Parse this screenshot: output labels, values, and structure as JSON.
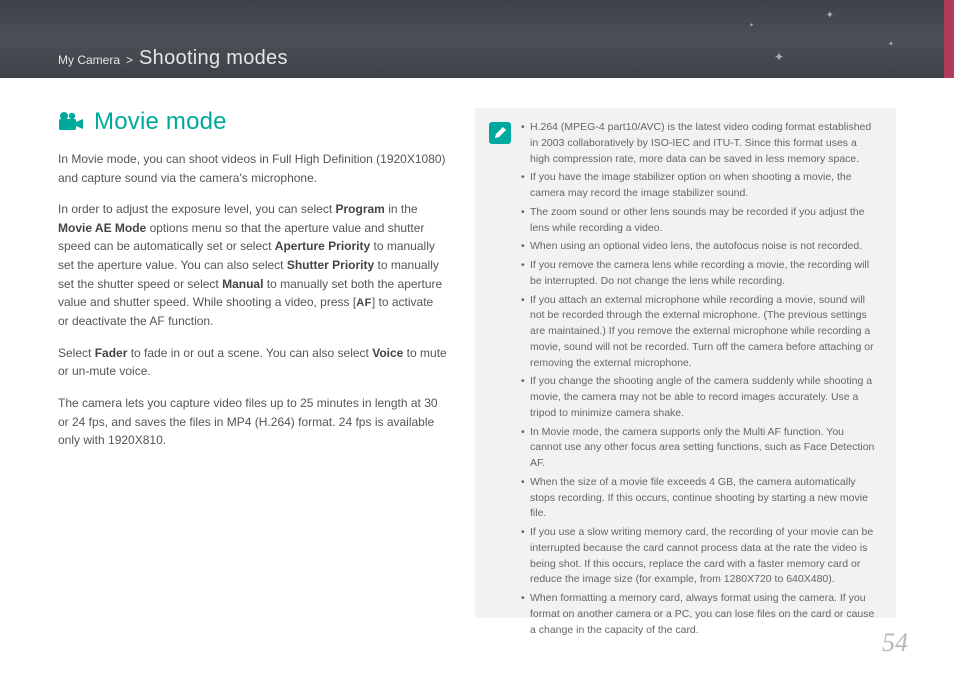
{
  "header": {
    "breadcrumb_category": "My Camera",
    "breadcrumb_sep": ">",
    "breadcrumb_section": "Shooting modes"
  },
  "heading": "Movie mode",
  "paragraphs": {
    "p1": "In Movie mode, you can shoot videos in Full High Definition (1920X1080) and capture sound via the camera's microphone.",
    "p2a": "In order to adjust the exposure level, you can select ",
    "p2_program": "Program",
    "p2b": " in the ",
    "p2_movieae": "Movie AE Mode",
    "p2c": " options menu so that the aperture value and shutter speed can be automatically set or select ",
    "p2_apPriority": "Aperture Priority",
    "p2d": " to manually set the aperture value. You can also select ",
    "p2_shPriority": "Shutter Priority",
    "p2e": " to manually set the shutter speed or select ",
    "p2_manual": "Manual",
    "p2f": " to manually set both the aperture value and shutter speed. While shooting a video, press [",
    "p2_af": "AF",
    "p2g": "] to activate or deactivate the AF function.",
    "p3a": "Select ",
    "p3_fader": "Fader",
    "p3b": " to fade in or out a scene. You can also select ",
    "p3_voice": "Voice",
    "p3c": " to mute or un-mute voice.",
    "p4": "The camera lets you capture video files up to 25 minutes in length at 30 or 24 fps, and saves the files in MP4 (H.264) format. 24 fps is available only with 1920X810."
  },
  "notes": [
    "H.264 (MPEG-4 part10/AVC) is the latest video coding format established in 2003 collaboratively by ISO-IEC and ITU-T. Since this format uses a high compression rate, more data can be saved in less memory space.",
    "If you have the image stabilizer option on when shooting a movie, the camera may record the image stabilizer sound.",
    "The zoom sound or other lens sounds may be recorded if you adjust the lens while recording a video.",
    "When using an optional video lens, the autofocus noise is not recorded.",
    "If you remove the camera lens while recording a movie, the recording will be interrupted. Do not change the lens while recording.",
    "If you attach an external microphone while recording a movie, sound will not be recorded through the external microphone. (The previous settings are maintained.) If you remove the external microphone while recording a movie, sound will not be recorded. Turn off the camera before attaching or removing the external microphone.",
    "If you change the shooting angle of the camera suddenly while shooting a movie, the camera may not be able to record images accurately. Use a tripod to minimize camera shake.",
    "In Movie mode, the camera supports only the Multi AF function. You cannot use any other focus area setting functions, such as Face Detection AF.",
    "When the size of a movie file exceeds 4 GB, the camera automatically stops recording. If this occurs, continue shooting by starting a new movie file.",
    "If you use a slow writing memory card, the recording of your movie can be interrupted because the card cannot process data at the rate the video is being shot. If this occurs, replace the card with a faster memory card or reduce the image size (for example, from 1280X720 to 640X480).",
    "When formatting a memory card, always format using the camera. If you format on another camera or a PC, you can lose files on the card or cause a change in the capacity of the card."
  ],
  "page_number": "54"
}
